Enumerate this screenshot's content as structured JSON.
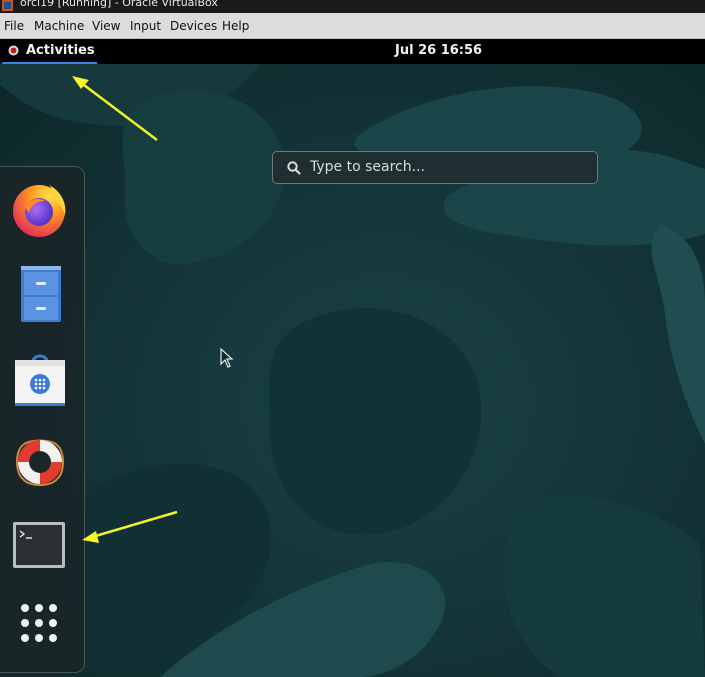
{
  "window": {
    "title": "orcl19 [Running] - Oracle VirtualBox"
  },
  "menubar": {
    "items": [
      "File",
      "Machine",
      "View",
      "Input",
      "Devices",
      "Help"
    ]
  },
  "topbar": {
    "activities_label": "Activities",
    "clock": "Jul 26  16:56"
  },
  "search": {
    "placeholder": "Type to search..."
  },
  "dock": {
    "apps": [
      {
        "name": "Firefox",
        "icon": "firefox-icon"
      },
      {
        "name": "Files",
        "icon": "file-cabinet-icon"
      },
      {
        "name": "Software",
        "icon": "software-bag-icon"
      },
      {
        "name": "Help",
        "icon": "lifebuoy-icon"
      },
      {
        "name": "Terminal",
        "icon": "terminal-icon"
      },
      {
        "name": "Show Applications",
        "icon": "app-grid-icon"
      }
    ]
  },
  "colors": {
    "accent": "#3584e4",
    "annotation_arrow": "#f5f52a",
    "desktop_bg": "#0f2a2c"
  }
}
